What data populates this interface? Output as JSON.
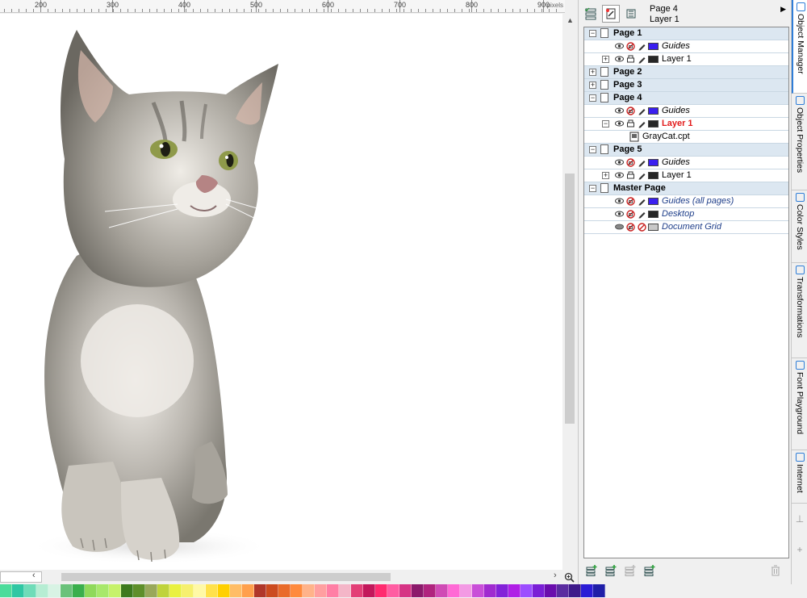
{
  "ruler": {
    "unit": "pixels",
    "labels": [
      "200",
      "300",
      "400",
      "500",
      "600",
      "700",
      "800",
      "900"
    ]
  },
  "canvas": {
    "image_subject": "gray kitten photo"
  },
  "page_selector": {
    "value": ""
  },
  "docker": {
    "current_page": "Page 4",
    "current_layer": "Layer 1",
    "tree": [
      {
        "type": "page",
        "label": "Page 1",
        "expanded": true
      },
      {
        "type": "layer",
        "label": "Guides",
        "style": "italic",
        "color": "#3a1ff0",
        "printable": false
      },
      {
        "type": "layer",
        "label": "Layer 1",
        "style": "normal",
        "color": "#262626",
        "printable": true,
        "expander": "+"
      },
      {
        "type": "page",
        "label": "Page 2",
        "expanded": false
      },
      {
        "type": "page",
        "label": "Page 3",
        "expanded": false
      },
      {
        "type": "page",
        "label": "Page 4",
        "expanded": true
      },
      {
        "type": "layer",
        "label": "Guides",
        "style": "italic",
        "color": "#3a1ff0",
        "printable": false
      },
      {
        "type": "layer",
        "label": "Layer 1",
        "style": "active",
        "color": "#262626",
        "printable": true,
        "expander": "−"
      },
      {
        "type": "object",
        "label": "GrayCat.cpt"
      },
      {
        "type": "page",
        "label": "Page 5",
        "expanded": true
      },
      {
        "type": "layer",
        "label": "Guides",
        "style": "italic",
        "color": "#3a1ff0",
        "printable": false
      },
      {
        "type": "layer",
        "label": "Layer 1",
        "style": "normal",
        "color": "#262626",
        "printable": true,
        "expander": "+"
      },
      {
        "type": "page",
        "label": "Master Page",
        "expanded": true
      },
      {
        "type": "layer",
        "label": "Guides (all pages)",
        "style": "master",
        "color": "#3a1ff0",
        "printable": false
      },
      {
        "type": "layer",
        "label": "Desktop",
        "style": "master",
        "color": "#262626",
        "printable": false
      },
      {
        "type": "layer",
        "label": "Document Grid",
        "style": "master",
        "color": "#c8c8c8",
        "printable": false,
        "hidden": true
      }
    ]
  },
  "side_tabs": [
    {
      "label": "Object Manager",
      "active": true
    },
    {
      "label": "Object Properties",
      "active": false
    },
    {
      "label": "Color Styles",
      "active": false
    },
    {
      "label": "Transformations",
      "active": false
    },
    {
      "label": "Font Playground",
      "active": false
    },
    {
      "label": "Internet",
      "active": false
    }
  ],
  "palette_colors": [
    "#4cdc9b",
    "#2fc7a3",
    "#6fdcb8",
    "#b6edd3",
    "#d8f3e4",
    "#6ac27a",
    "#3aaf4c",
    "#8fd95a",
    "#a8e86b",
    "#c6f26a",
    "#3d7a1d",
    "#5e8f2a",
    "#98a85a",
    "#bfd33b",
    "#e9f140",
    "#f6f06e",
    "#fff9a6",
    "#ffe14b",
    "#ffd000",
    "#ffbd66",
    "#ffa04d",
    "#b0372a",
    "#cc4b1f",
    "#e96b2a",
    "#ff8a3d",
    "#ffb38a",
    "#ff9fa0",
    "#ff7fa5",
    "#f4b6c8",
    "#e33f77",
    "#c2185b",
    "#ff2b6f",
    "#ff5da2",
    "#d63384",
    "#8b1a6b",
    "#b0247e",
    "#d04bb5",
    "#ff6ad5",
    "#f39ae4",
    "#c94fd8",
    "#a02bd0",
    "#8322d9",
    "#b01fe6",
    "#9c4dff",
    "#7a1fd6",
    "#6a0dad",
    "#5a2ca0",
    "#3d1a8a",
    "#2b1cd6",
    "#1f1fa8"
  ]
}
